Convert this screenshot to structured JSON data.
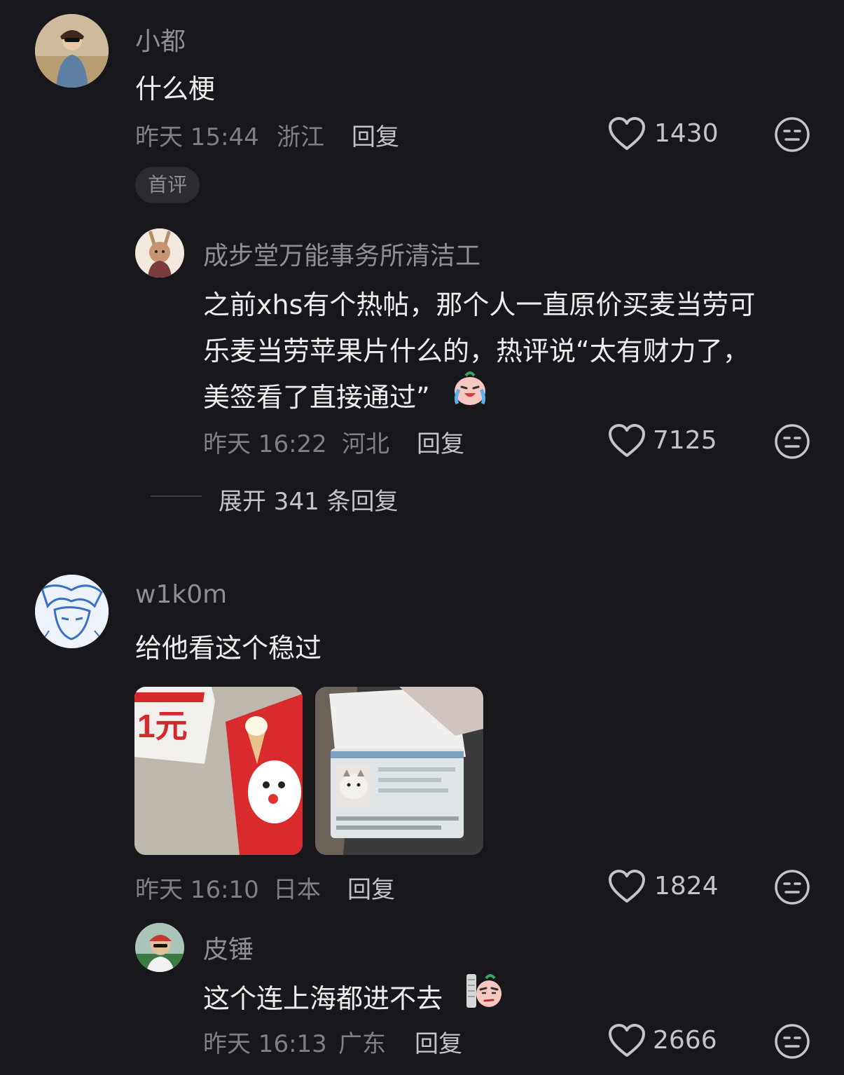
{
  "comments": [
    {
      "username": "小都",
      "text": "什么梗",
      "time": "昨天 15:44",
      "location": "浙江",
      "reply_label": "回复",
      "likes": "1430",
      "badge": "首评",
      "icons": {
        "like": "heart-icon",
        "dislike": "meh-face-icon"
      }
    },
    {
      "username": "w1k0m",
      "text": "给他看这个稳过",
      "time": "昨天 16:10",
      "location": "日本",
      "reply_label": "回复",
      "likes": "1824",
      "images": [
        "dairy-queen-1-yuan-coupon-photo",
        "passport-us-visa-cat-photo"
      ]
    }
  ],
  "replies": [
    {
      "username": "成步堂万能事务所清洁工",
      "text_lines": [
        "之前xhs有个热帖，那个人一直原价买麦当劳可",
        "乐麦当劳苹果片什么的，热评说“太有财力了，",
        "美签看了直接通过”"
      ],
      "emoji": "laugh-cry-emoji",
      "time": "昨天 16:22",
      "location": "河北",
      "reply_label": "回复",
      "likes": "7125"
    },
    {
      "username": "皮锤",
      "text": "这个连上海都进不去",
      "emoji": "eyebrow-raise-emoji",
      "time": "昨天 16:13",
      "location": "广东",
      "reply_label": "回复",
      "likes": "2666"
    }
  ],
  "expand_replies_label": "展开 341 条回复",
  "colors": {
    "background": "#18181c",
    "text": "#ededef",
    "muted": "#8e8e94"
  }
}
